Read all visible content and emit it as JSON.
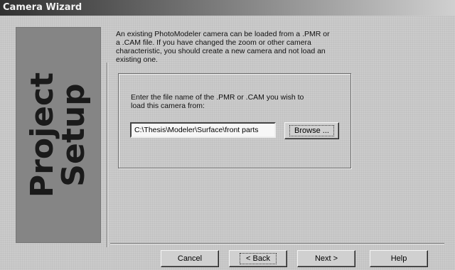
{
  "window": {
    "title": "Camera Wizard"
  },
  "banner": {
    "line1": "Project",
    "line2": "Setup"
  },
  "intro_text": "An existing PhotoModeler camera can be loaded from a .PMR or\na .CAM file.  If you have changed the zoom or other camera\ncharacteristic, you should create a new camera and not load an\nexisting one.",
  "file_section": {
    "prompt": "Enter the file name of the .PMR or .CAM you wish to\nload this camera from:",
    "file_value": "C:\\Thesis\\Modeler\\Surface\\front parts",
    "browse_label": "Browse ..."
  },
  "buttons": {
    "cancel": "Cancel",
    "back": "< Back",
    "next": "Next >",
    "help": "Help"
  },
  "colors": {
    "titlebar_dark": "#303030",
    "window_bg": "#cbcbcb",
    "banner_bg": "#9a9a9a"
  }
}
